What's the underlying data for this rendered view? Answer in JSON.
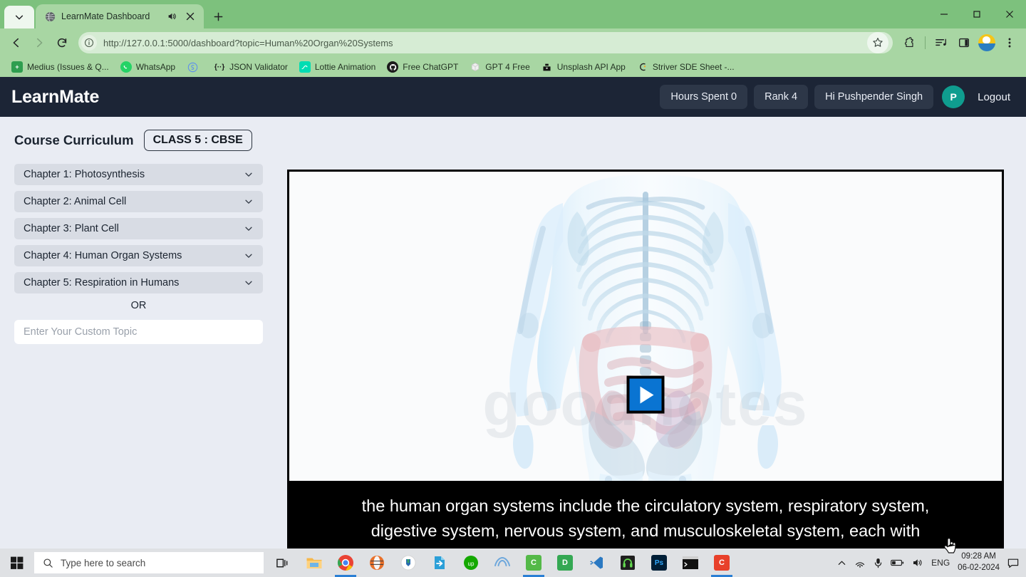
{
  "browser": {
    "tab": {
      "title": "LearnMate Dashboard",
      "favicon": "globe-icon",
      "audio_icon": "speaker-icon",
      "close_icon": "close-icon"
    },
    "new_tab_label": "+",
    "window_controls": {
      "minimize": "—",
      "maximize": "❐",
      "close": "✕"
    },
    "url": "http://127.0.0.1:5000/dashboard?topic=Human%20Organ%20Systems",
    "nav": {
      "back": "back-icon",
      "forward": "forward-icon",
      "reload": "reload-icon"
    },
    "bookmarks": [
      {
        "label": "Medius (Issues & Q...",
        "icon_text": "+",
        "icon_color": "#2e9e4f"
      },
      {
        "label": "WhatsApp",
        "icon_text": "",
        "icon_color": "#25d366"
      },
      {
        "label": "",
        "icon_text": "",
        "icon_color": "#5b8def"
      },
      {
        "label": "JSON Validator",
        "icon_text": "{··}",
        "icon_color": "#ffffff"
      },
      {
        "label": "Lottie Animation",
        "icon_text": "✓",
        "icon_color": "#00ddb3"
      },
      {
        "label": "Free ChatGPT",
        "icon_text": "",
        "icon_color": "#1b1b1b"
      },
      {
        "label": "GPT 4 Free",
        "icon_text": "",
        "icon_color": "#e8e8e8"
      },
      {
        "label": "Unsplash API App",
        "icon_text": "",
        "icon_color": "#111111"
      },
      {
        "label": "Striver SDE Sheet -...",
        "icon_text": "",
        "icon_color": "#f5a623"
      }
    ]
  },
  "app": {
    "brand": "LearnMate",
    "header_actions": {
      "hours_spent": "Hours Spent 0",
      "rank": "Rank 4",
      "greeting": "Hi Pushpender Singh",
      "avatar_initial": "P",
      "logout": "Logout"
    },
    "accent_colors": {
      "appbar_bg": "#1c2536",
      "pill_bg": "#2d3748",
      "avatar_bg": "#0f9d8f",
      "play_button": "#0a74d2",
      "page_bg": "#e9ecf3"
    }
  },
  "sidebar": {
    "title": "Course Curriculum",
    "class_badge": "CLASS 5 : CBSE",
    "chapters": [
      {
        "label": "Chapter 1: Photosynthesis"
      },
      {
        "label": "Chapter 2: Animal Cell"
      },
      {
        "label": "Chapter 3: Plant Cell"
      },
      {
        "label": "Chapter 4: Human Organ Systems"
      },
      {
        "label": "Chapter 5: Respiration in Humans"
      }
    ],
    "divider_text": "OR",
    "custom_topic": {
      "value": "",
      "placeholder": "Enter Your Custom Topic"
    }
  },
  "video": {
    "play_label": "Play",
    "caption_line_1": "the human organ systems include the circulatory system, respiratory system,",
    "caption_line_2": "digestive system, nervous system, and musculoskeletal system, each with",
    "watermark": "goodnotes"
  },
  "taskbar": {
    "start_icon": "windows-icon",
    "search_placeholder": "Type here to search",
    "task_view": "task-view-icon",
    "apps": [
      {
        "name": "file-explorer",
        "color": "#ffb900",
        "text": ""
      },
      {
        "name": "google-chrome",
        "color": "#ffffff",
        "text": ""
      },
      {
        "name": "opera",
        "color": "#e06b4a",
        "text": ""
      },
      {
        "name": "app-blue-circle",
        "color": "#ffffff",
        "text": ""
      },
      {
        "name": "file-transfer",
        "color": "#2b9fd8",
        "text": ""
      },
      {
        "name": "upwork",
        "color": "#14a800",
        "text": ""
      },
      {
        "name": "framer",
        "color": "#5b9bd5",
        "text": ""
      },
      {
        "name": "camtasia",
        "color": "#54b948",
        "text": "C"
      },
      {
        "name": "docs-app",
        "color": "#34a853",
        "text": "D"
      },
      {
        "name": "vs-code",
        "color": "#ffffff",
        "text": ""
      },
      {
        "name": "audacity",
        "color": "#1f1f1f",
        "text": ""
      },
      {
        "name": "photoshop",
        "color": "#001e36",
        "text": "Ps"
      },
      {
        "name": "terminal",
        "color": "#1b1b1b",
        "text": ""
      },
      {
        "name": "camtasia-red",
        "color": "#e8402a",
        "text": "C"
      }
    ],
    "tray": {
      "language": "ENG",
      "time": "09:28 AM",
      "date": "06-02-2024"
    }
  }
}
